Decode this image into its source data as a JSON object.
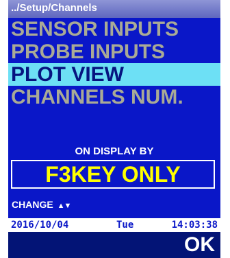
{
  "breadcrumb": "../Setup/Channels",
  "menu": {
    "items": [
      {
        "label": "SENSOR INPUTS",
        "selected": false
      },
      {
        "label": "PROBE INPUTS",
        "selected": false
      },
      {
        "label": "PLOT VIEW",
        "selected": true
      },
      {
        "label": "CHANNELS NUM.",
        "selected": false
      }
    ]
  },
  "setting": {
    "label": "ON DISPLAY BY",
    "value": "F3KEY ONLY"
  },
  "change": {
    "label": "CHANGE",
    "arrows": "▲▼"
  },
  "status": {
    "date": "2016/10/04",
    "day": "Tue",
    "time": "14:03:38"
  },
  "softkey": {
    "ok_label": "OK"
  },
  "colors": {
    "background": "#0a17c8",
    "selected_bg": "#6de0f5",
    "dim_text": "#a9aa96",
    "value_text": "#ffff00"
  }
}
